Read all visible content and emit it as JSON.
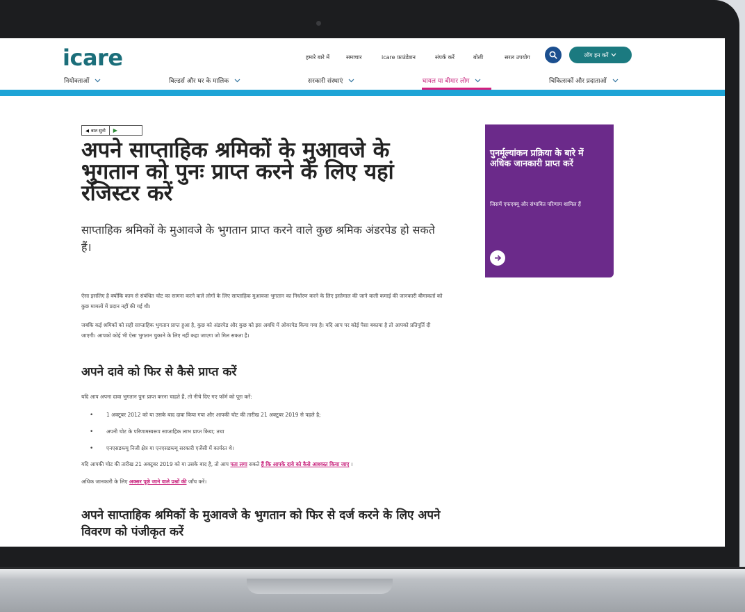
{
  "header": {
    "logo": "icare",
    "top_links": [
      "हमारे बारे में",
      "समाचार",
      "icare फ़ाउंडेशन",
      "संपर्क करें",
      "बोली",
      "सरल उपयोग"
    ],
    "login_label": "लॉग इन करें"
  },
  "main_nav": [
    "नियोक्ताओं",
    "बिल्डर्स और घर के मालिक",
    "सरकारी संस्थाएं",
    "घायल या बीमार लोग",
    "चिकित्सकों और प्रदाताओं"
  ],
  "audio": {
    "label": "बात सुनो"
  },
  "page": {
    "title": "अपने साप्ताहिक श्रमिकों के मुआवजे के भुगतान को पुनः प्राप्त करने के लिए यहां रजिस्टर करें",
    "lead": "साप्ताहिक श्रमिकों के मुआवजे के भुगतान प्राप्त करने वाले कुछ श्रमिक अंडरपेड हो सकते हैं।",
    "para1": "ऐसा इसलिए है क्योंकि काम से संबंधित चोट का सामना करने वाले लोगों के लिए साप्ताहिक मुआवजा भुगतान का निर्धारण करने के लिए इस्तेमाल की जाने वाली कमाई की जानकारी बीमाकर्ता को कुछ मामलों में प्रदान नहीं की गई थी।",
    "para2": "जबकि कई श्रमिकों को सही साप्ताहिक भुगतान प्राप्त हुआ है, कुछ को अंडरपेड और कुछ को इस अवधि में ओवरपेड किया गया है। यदि आप पर कोई पैसा बकाया है तो आपको प्रतिपूर्ति दी जाएगी। आपको कोई भी ऐसा भुगतान चुकाने के लिए नहीं कहा जाएगा जो मिल सकता है।",
    "h2_1": "अपने दावे को फिर से कैसे प्राप्त करें",
    "para3": "यदि आप अपना दावा भुगतान पुनः प्राप्त करना चाहते हैं, तो नीचे दिए गए फॉर्म को पूरा करें:",
    "bullets": [
      "1 अक्टूबर 2012 को या उसके बाद दावा किया गया और आपकी चोट की तारीख 21 अक्टूबर 2019 से पहले है;",
      "अपनी चोट के परिणामस्वरूप साप्ताहिक लाभ प्राप्त किया; तथा",
      "एनएसडब्ल्यू निजी क्षेत्र या एनएसडब्ल्यू सरकारी एजेंसी में कार्यरत थे।"
    ],
    "para4_pre": "यदि आपकी चोट की तारीख 21 अक्टूबर 2019 को या उसके बाद है, तो आप",
    "para4_link1": "पता लगा",
    "para4_mid": "सकते",
    "para4_link2": "हैं कि आपके दावे को कैसे आश्वस्त किया जाए",
    "para4_end": "।",
    "para5_pre": "अधिक जानकारी के लिए",
    "para5_link": "अक्सर पूछे जाने वाले प्रश्नों की",
    "para5_end": "जाँच करें।",
    "h2_2": "अपने साप्ताहिक श्रमिकों के मुआवजे के भुगतान को फिर से दर्ज करने के लिए अपने विवरण को पंजीकृत करें"
  },
  "card": {
    "title": "पुनर्मूल्यांकन प्रक्रिया के बारे में अधिक जानकारी प्राप्त करें",
    "subtitle": "जिसमें एफएक्यू और संभावित परिणाम शामिल हैं"
  },
  "colors": {
    "brand_teal": "#1b6e7a",
    "accent_pink": "#c71f7a",
    "card_purple": "#6b2a8a",
    "stripe_blue": "#1ea4d6"
  }
}
